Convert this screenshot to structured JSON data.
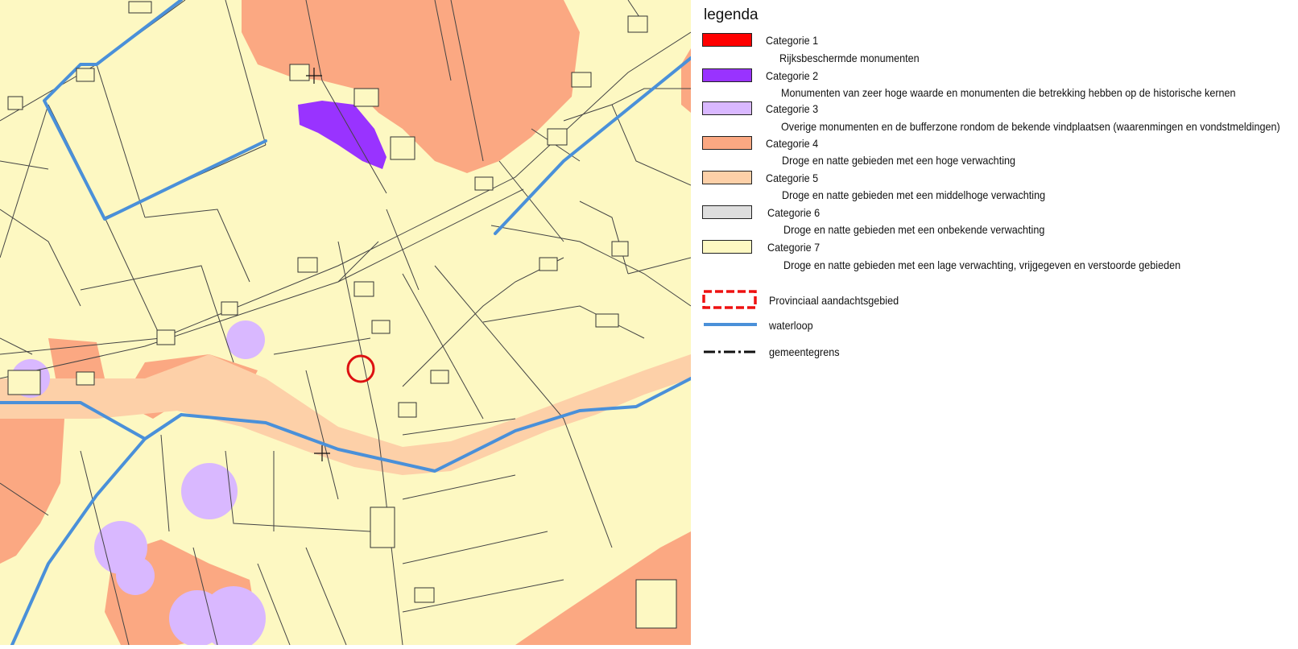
{
  "legend": {
    "title": "legenda",
    "categories": [
      {
        "label": "Categorie 1",
        "desc": "Rijksbeschermde monumenten",
        "color": "#ff0000"
      },
      {
        "label": "Categorie 2",
        "desc": "Monumenten van zeer hoge waarde en monumenten die betrekking hebben op de historische kernen",
        "color": "#9933ff"
      },
      {
        "label": "Categorie 3",
        "desc": "Overige monumenten en de bufferzone rondom de bekende vindplaatsen (waarenmingen en vondstmeldingen)",
        "color": "#d9b8ff"
      },
      {
        "label": "Categorie 4",
        "desc": "Droge en natte gebieden met een hoge verwachting",
        "color": "#fba882"
      },
      {
        "label": "Categorie 5",
        "desc": "Droge en natte gebieden met een middelhoge verwachting",
        "color": "#fdd0a8"
      },
      {
        "label": "Categorie 6",
        "desc": "Droge en natte gebieden met een onbekende verwachting",
        "color": "#dedede"
      },
      {
        "label": "Categorie 7",
        "desc": "Droge en natte gebieden met een lage verwachting, vrijgegeven en verstoorde gebieden",
        "color": "#fdf8c2"
      }
    ],
    "extra": [
      {
        "label": "Provinciaal aandachtsgebied",
        "symbol": "dashed-red-box"
      },
      {
        "label": "waterloop",
        "symbol": "blue-line"
      },
      {
        "label": "gemeentegrens",
        "symbol": "dash-dot-line"
      }
    ]
  },
  "map": {
    "background_color": "#fdf8c2",
    "water_color": "#4a90d9",
    "marker_color": "#dd1111"
  }
}
